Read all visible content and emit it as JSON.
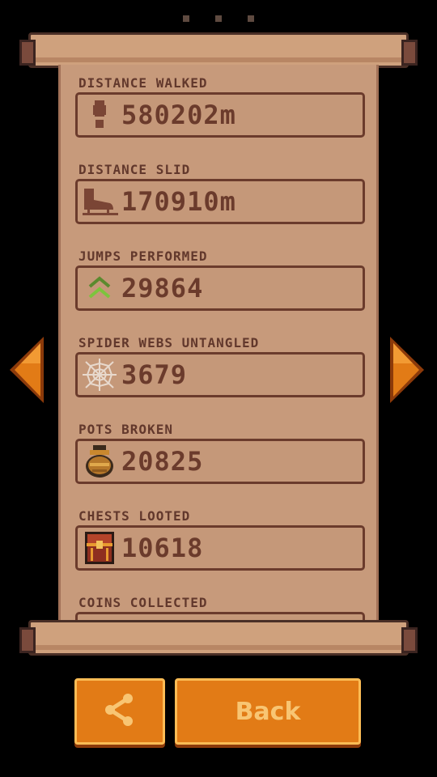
{
  "pager": {
    "dots": 3
  },
  "stats": [
    {
      "label": "DISTANCE WALKED",
      "value": "580202m",
      "icon": "footprint-icon"
    },
    {
      "label": "DISTANCE SLID",
      "value": "170910m",
      "icon": "ice-skate-icon"
    },
    {
      "label": "JUMPS PERFORMED",
      "value": "29864",
      "icon": "double-chevron-up-icon"
    },
    {
      "label": "SPIDER WEBS UNTANGLED",
      "value": "3679",
      "icon": "spider-web-icon"
    },
    {
      "label": "POTS BROKEN",
      "value": "20825",
      "icon": "pot-icon"
    },
    {
      "label": "CHESTS LOOTED",
      "value": "10618",
      "icon": "chest-icon"
    },
    {
      "label": "COINS COLLECTED",
      "value": "",
      "icon": "coin-icon"
    }
  ],
  "buttons": {
    "share_icon": "share-icon",
    "back_label": "Back"
  },
  "colors": {
    "accent": "#e27b16",
    "parchment": "#c79a7b",
    "text": "#6b3b2c"
  }
}
